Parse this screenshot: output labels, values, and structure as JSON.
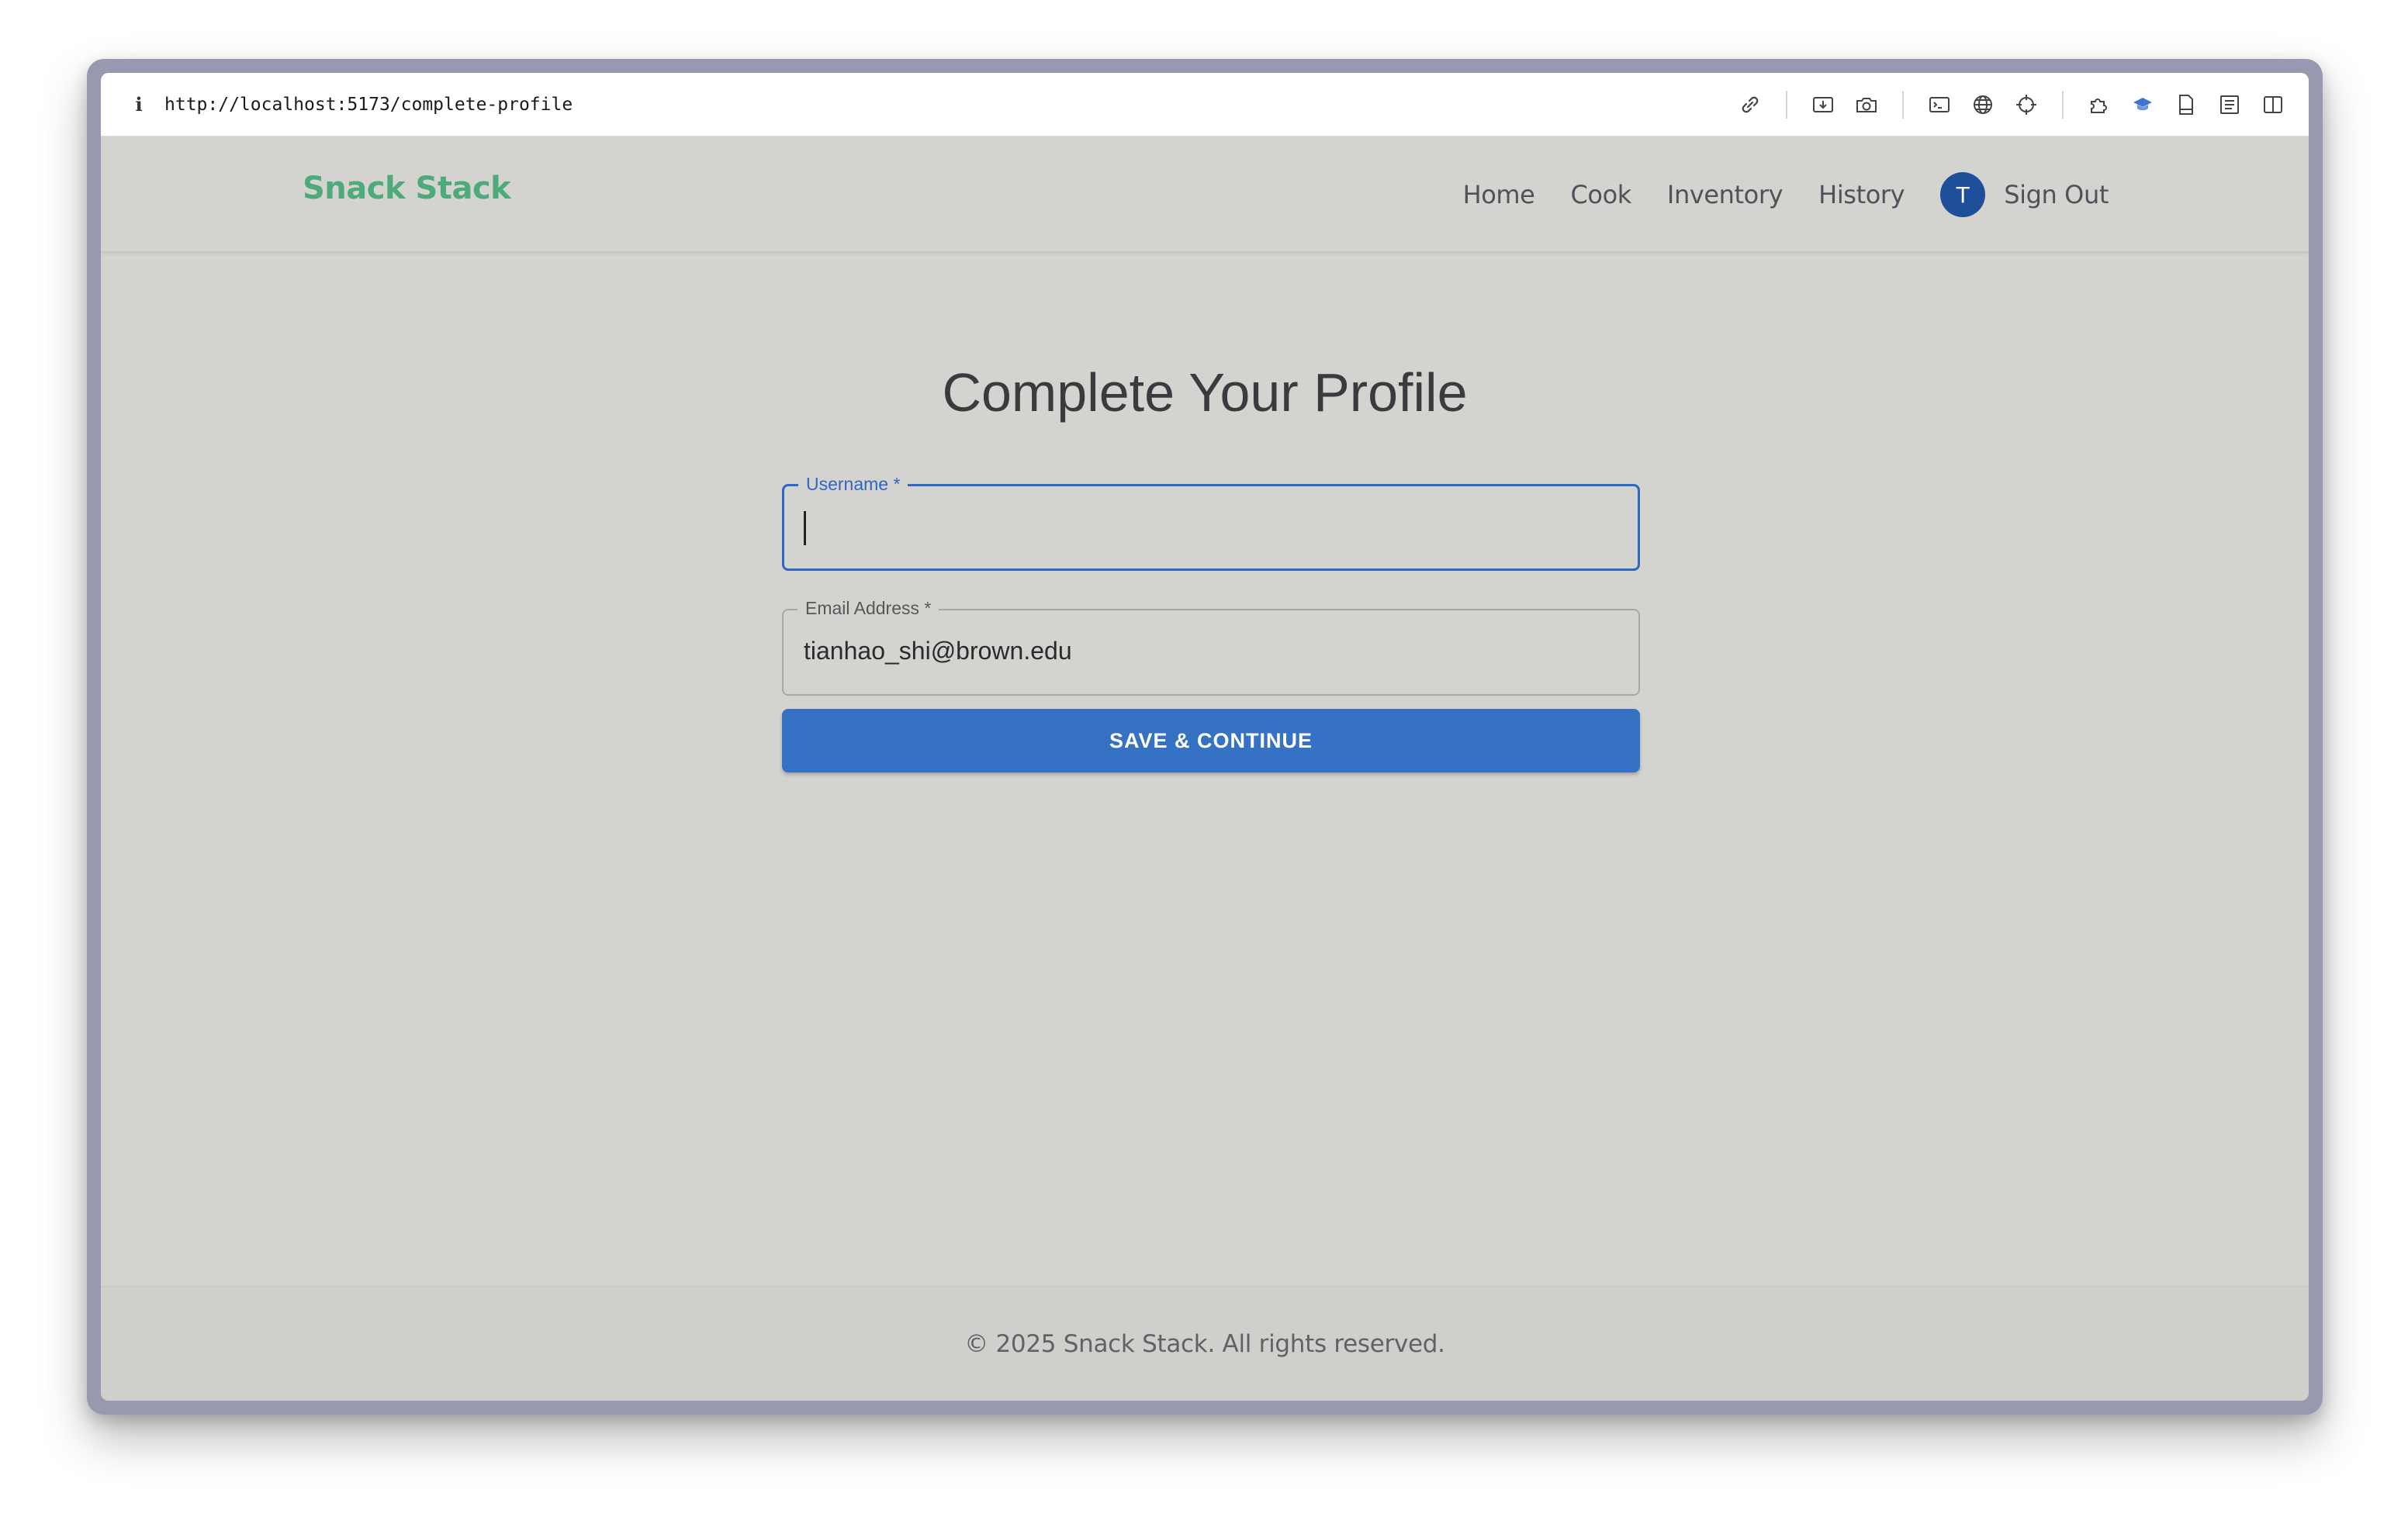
{
  "browser": {
    "url": "http://localhost:5173/complete-profile",
    "info_icon": "i",
    "toolbar_icons": [
      "link-icon",
      "download-icon",
      "camera-icon",
      "terminal-icon",
      "globe-icon",
      "crosshair-icon",
      "extension-icon",
      "bookmark-icon",
      "page-icon",
      "reader-icon",
      "sidebar-icon"
    ]
  },
  "navbar": {
    "brand": "Snack Stack",
    "links": [
      "Home",
      "Cook",
      "Inventory",
      "History"
    ],
    "avatar_initial": "T",
    "sign_out": "Sign Out"
  },
  "main": {
    "title": "Complete Your Profile",
    "username_label": "Username *",
    "username_value": "",
    "email_label": "Email Address *",
    "email_value": "tianhao_shi@brown.edu",
    "save_button": "SAVE & CONTINUE"
  },
  "footer": {
    "text": "© 2025 Snack Stack. All rights reserved."
  },
  "colors": {
    "brand": "#4caa7b",
    "primary": "#3672c4",
    "avatar": "#1f4f9a",
    "background": "#d4d3d0"
  }
}
